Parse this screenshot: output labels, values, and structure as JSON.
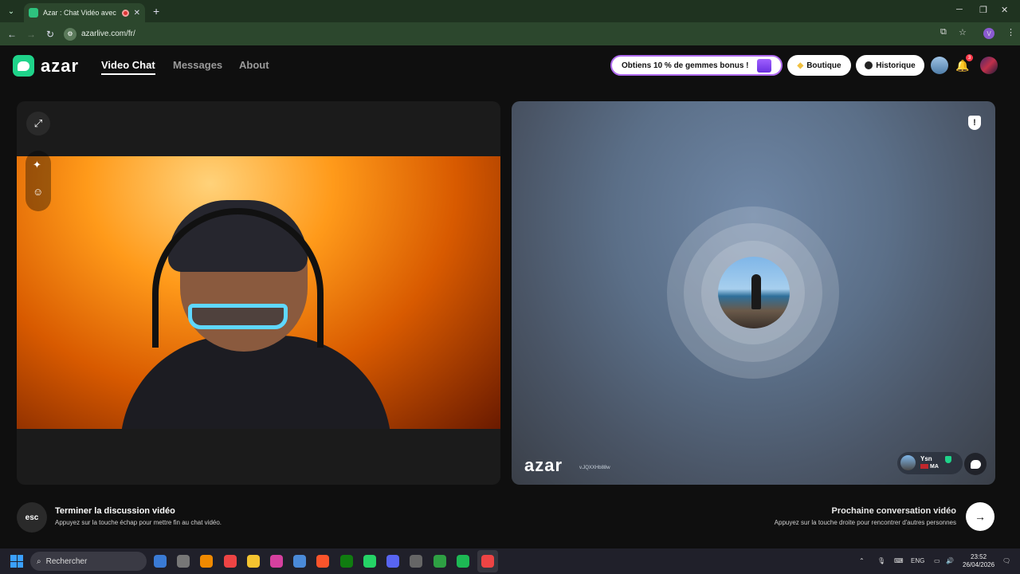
{
  "browser": {
    "tab_title": "Azar : Chat Vidéo avec de",
    "tab_close": "✕",
    "new_tab": "+",
    "tab_menu": "⌄",
    "url": "azarlive.com/fr/",
    "profile_initial": "V",
    "window_controls": {
      "minimize": "─",
      "maximize": "❐",
      "close": "✕"
    }
  },
  "header": {
    "logo_text": "azar",
    "nav": [
      {
        "label": "Video Chat",
        "active": true
      },
      {
        "label": "Messages",
        "active": false
      },
      {
        "label": "About",
        "active": false
      }
    ],
    "promo_label": "Obtiens 10 % de gemmes bonus !",
    "boutique_label": "Boutique",
    "historique_label": "Historique",
    "notification_count": "3"
  },
  "right_panel": {
    "watermark": "azar",
    "watermark_id": "v.JQXXHb88w",
    "partner_name": "Ysn",
    "partner_country": "MA"
  },
  "bottom": {
    "esc_key": "esc",
    "end_title": "Terminer la discussion vidéo",
    "end_subtitle": "Appuyez sur la touche échap pour mettre fin au chat vidéo.",
    "next_title": "Prochaine conversation vidéo",
    "next_subtitle": "Appuyez sur la touche droite pour rencontrer d'autres personnes"
  },
  "taskbar": {
    "search_placeholder": "Rechercher",
    "language": "ENG",
    "time": "23:52",
    "date": "26/04/2026"
  },
  "colors": {
    "brand": "#1fd38a",
    "browser_frame": "#1f3320",
    "page_bg": "#0f0f0f",
    "promo_border": "#b06bf0",
    "notification": "#ff3b4b"
  }
}
